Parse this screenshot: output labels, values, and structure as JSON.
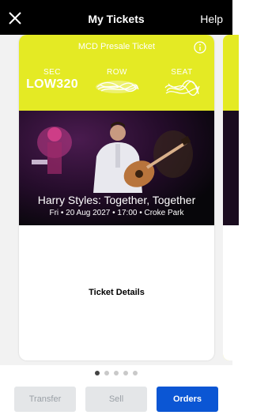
{
  "header": {
    "title": "My Tickets",
    "help_label": "Help"
  },
  "ticket": {
    "presale_label": "MCD Presale Ticket",
    "section": {
      "label": "SEC",
      "value": "LOW320"
    },
    "row": {
      "label": "ROW"
    },
    "seat": {
      "label": "SEAT"
    },
    "event_name": "Harry Styles: Together, Together",
    "event_meta": "Fri • 20 Aug 2027 • 17:00 • Croke Park",
    "details_label": "Ticket Details"
  },
  "pager": {
    "count": 5,
    "active_index": 0
  },
  "actions": {
    "transfer_label": "Transfer",
    "sell_label": "Sell",
    "orders_label": "Orders"
  },
  "colors": {
    "accent_yellow": "#e4ea24",
    "primary_blue": "#0b56d4",
    "disabled_gray": "#e4e6e8"
  }
}
